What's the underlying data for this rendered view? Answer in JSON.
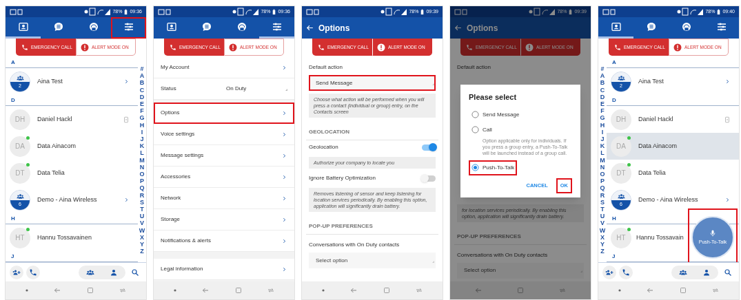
{
  "screens": [
    {
      "kind": "contacts",
      "battery": "78%",
      "time": "09:36",
      "tabs": [
        {
          "selected": true,
          "highlighted": false
        },
        {
          "selected": false,
          "highlighted": false
        },
        {
          "selected": false,
          "highlighted": false
        },
        {
          "selected": false,
          "highlighted": true
        }
      ],
      "emergency": {
        "call_label": "EMERGENCY CALL",
        "alert_label": "ALERT MODE ON",
        "alert_on": false
      },
      "panes": [
        {
          "kind": "list",
          "sections": [
            {
              "letter": "A",
              "contacts": [
                {
                  "kind": "group",
                  "members": "2",
                  "name": "Aina Test",
                  "selected": false
                }
              ]
            },
            {
              "letter": "D",
              "contacts": [
                {
                  "kind": "person",
                  "initials": "DH",
                  "name": "Daniel Hackl",
                  "online": false,
                  "device": true,
                  "selected": false
                },
                {
                  "kind": "person",
                  "initials": "DA",
                  "name": "Data Ainacom",
                  "online": true,
                  "device": false,
                  "selected": false
                },
                {
                  "kind": "person",
                  "initials": "DT",
                  "name": "Data Telia",
                  "online": true,
                  "device": false,
                  "selected": false
                },
                {
                  "kind": "group",
                  "members": "6",
                  "name": "Demo - Aina Wireless",
                  "selected": false
                }
              ]
            },
            {
              "letter": "H",
              "contacts": [
                {
                  "kind": "person",
                  "initials": "HT",
                  "name": "Hannu Tossavainen",
                  "online": true,
                  "device": false,
                  "selected": false
                }
              ]
            },
            {
              "letter": "J"
            }
          ]
        },
        {
          "kind": "index",
          "letters": [
            "#",
            "A",
            "B",
            "C",
            "D",
            "E",
            "F",
            "G",
            "H",
            "I",
            "J",
            "K",
            "L",
            "M",
            "N",
            "O",
            "P",
            "Q",
            "R",
            "S",
            "T",
            "U",
            "V",
            "W",
            "X",
            "Y",
            "Z"
          ]
        }
      ]
    },
    {
      "kind": "settings",
      "battery": "78%",
      "time": "09:36",
      "tabs": [
        {
          "selected": false,
          "highlighted": false
        },
        {
          "selected": false,
          "highlighted": false
        },
        {
          "selected": false,
          "highlighted": false
        },
        {
          "selected": true,
          "highlighted": false
        }
      ],
      "emergency": {
        "call_label": "EMERGENCY CALL",
        "alert_label": "ALERT MODE ON",
        "alert_on": false
      },
      "groups": [
        [
          {
            "kind": "link",
            "label": "My Account",
            "highlighted": false
          },
          {
            "kind": "select",
            "label": "Status",
            "value": "On Duty"
          }
        ],
        [
          {
            "kind": "link",
            "label": "Options",
            "highlighted": true
          },
          {
            "kind": "link",
            "label": "Voice settings",
            "highlighted": false
          },
          {
            "kind": "link",
            "label": "Message settings",
            "highlighted": false
          },
          {
            "kind": "link",
            "label": "Accessories",
            "highlighted": false
          },
          {
            "kind": "link",
            "label": "Network",
            "highlighted": false
          },
          {
            "kind": "link",
            "label": "Storage",
            "highlighted": false
          },
          {
            "kind": "link",
            "label": "Notifications & alerts",
            "highlighted": false
          }
        ],
        [
          {
            "kind": "link",
            "label": "Legal information",
            "highlighted": false
          }
        ]
      ]
    },
    {
      "kind": "options",
      "battery": "78%",
      "time": "09:39",
      "title": "Options",
      "emergency": {
        "call_label": "EMERGENCY CALL",
        "alert_label": "ALERT MODE ON",
        "alert_on": true
      },
      "items": [
        {
          "kind": "label",
          "text": "Default action"
        },
        {
          "kind": "field",
          "value": "Send Message",
          "highlighted": true
        },
        {
          "kind": "help",
          "text": "Choose what action will be performed when you will press a contact (individual or group) entry, on the Contacts screen"
        },
        {
          "kind": "section",
          "text": "GEOLOCATION"
        },
        {
          "kind": "toggle",
          "label": "Geolocation",
          "on": true
        },
        {
          "kind": "help",
          "text": "Authorize your company to locate you"
        },
        {
          "kind": "toggle",
          "label": "Ignore Battery Optimization",
          "on": false
        },
        {
          "kind": "help",
          "text": "Removes listening of sensor and keep listening for location services periodically. By enabling this option, application will significantly drain battery."
        },
        {
          "kind": "section",
          "text": "POP-UP PREFERENCES"
        },
        {
          "kind": "label",
          "text": "Conversations with On Duty contacts"
        },
        {
          "kind": "field",
          "placeholder": "Select option",
          "highlighted": false
        }
      ]
    },
    {
      "kind": "options",
      "battery": "78%",
      "time": "09:39",
      "title": "Options",
      "dimmed": true,
      "emergency": {
        "call_label": "EMERGENCY CALL",
        "alert_label": "ALERT MODE ON",
        "alert_on": true
      },
      "items": [
        {
          "kind": "label",
          "text": "Default action"
        },
        {
          "kind": "dialog",
          "title": "Please select",
          "options": [
            {
              "label": "Send Message",
              "selected": false,
              "highlighted": false
            },
            {
              "label": "Call",
              "selected": false,
              "highlighted": false,
              "note": "Option applicable only for individuals. If you press a group entry, a Push-To-Talk will be launched instead of a group call."
            },
            {
              "label": "Push-To-Talk",
              "selected": true,
              "highlighted": true
            }
          ],
          "buttons": [
            {
              "label": "CANCEL",
              "highlighted": false
            },
            {
              "label": "OK",
              "highlighted": true
            }
          ]
        },
        {
          "kind": "help",
          "text": "for location services periodically. By enabling this option, application will significantly drain battery."
        },
        {
          "kind": "section",
          "text": "POP-UP PREFERENCES"
        },
        {
          "kind": "label",
          "text": "Conversations with On Duty contacts"
        },
        {
          "kind": "field",
          "placeholder": "Select option",
          "highlighted": false
        }
      ]
    },
    {
      "kind": "contacts",
      "battery": "78%",
      "time": "09:40",
      "tabs": [
        {
          "selected": true,
          "highlighted": false
        },
        {
          "selected": false,
          "highlighted": false
        },
        {
          "selected": false,
          "highlighted": false
        },
        {
          "selected": false,
          "highlighted": false
        }
      ],
      "emergency": {
        "call_label": "EMERGENCY CALL",
        "alert_label": "ALERT MODE ON",
        "alert_on": false
      },
      "panes": [
        {
          "kind": "index",
          "letters": [
            "#",
            "A",
            "B",
            "C",
            "D",
            "E",
            "F",
            "G",
            "H",
            "I",
            "J",
            "K",
            "L",
            "M",
            "N",
            "O",
            "P",
            "Q",
            "R",
            "S",
            "T",
            "U",
            "V",
            "W",
            "X",
            "Y",
            "Z"
          ]
        },
        {
          "kind": "list",
          "sections": [
            {
              "letter": "A",
              "contacts": [
                {
                  "kind": "group",
                  "members": "2",
                  "name": "Aina Test",
                  "selected": false
                }
              ]
            },
            {
              "letter": "D",
              "contacts": [
                {
                  "kind": "person",
                  "initials": "DH",
                  "name": "Daniel Hackl",
                  "online": false,
                  "device": true,
                  "selected": false
                },
                {
                  "kind": "person",
                  "initials": "DA",
                  "name": "Data Ainacom",
                  "online": true,
                  "device": false,
                  "selected": true
                },
                {
                  "kind": "person",
                  "initials": "DT",
                  "name": "Data Telia",
                  "online": true,
                  "device": false,
                  "selected": false
                },
                {
                  "kind": "group",
                  "members": "6",
                  "name": "Demo - Aina Wireless",
                  "selected": false
                }
              ]
            },
            {
              "letter": "H",
              "contacts": [
                {
                  "kind": "person",
                  "initials": "HT",
                  "name": "Hannu Tossavain",
                  "online": true,
                  "device": false,
                  "selected": false
                }
              ]
            },
            {
              "letter": "J"
            }
          ]
        }
      ],
      "push_to_talk": {
        "label": "Push-To-Talk",
        "highlighted": true
      }
    }
  ]
}
